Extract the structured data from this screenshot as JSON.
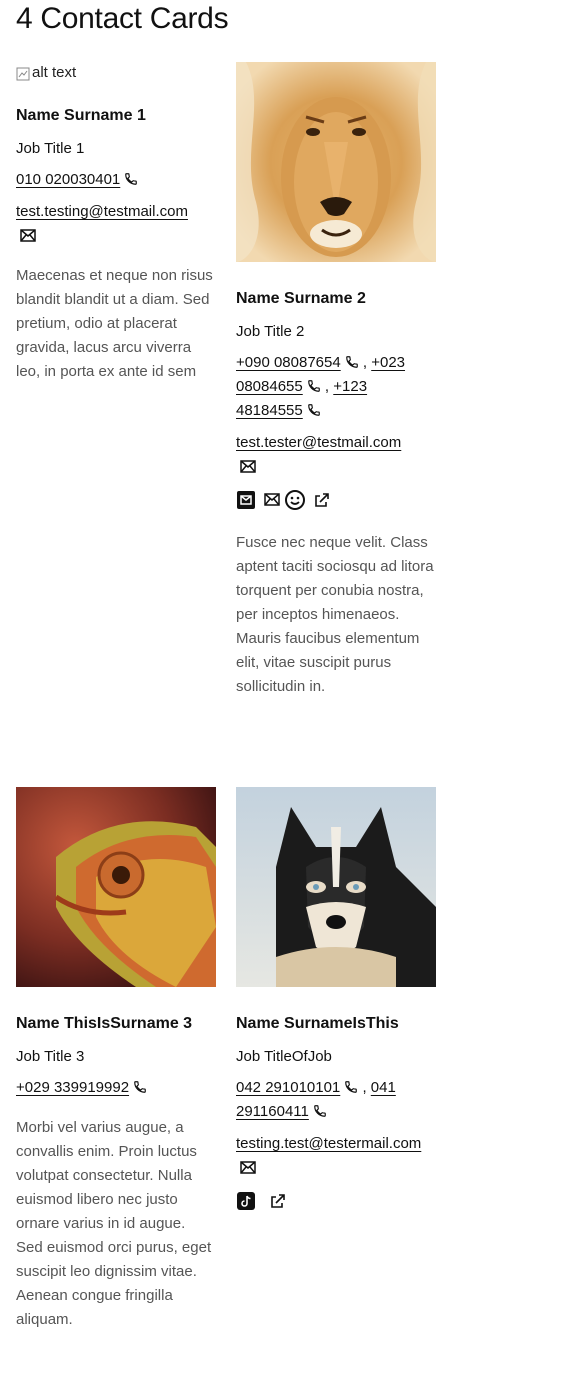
{
  "page": {
    "title": "4 Contact Cards"
  },
  "cards": [
    {
      "image_alt": "alt text",
      "name": "Name Surname 1",
      "job_title": "Job Title 1",
      "phones": [
        "010 020030401"
      ],
      "email": "test.testing@testmail.com",
      "description": "Maecenas et neque non risus blandit blandit ut a diam. Sed pretium, odio at placerat gravida, lacus arcu viverra leo, in porta ex ante id sem"
    },
    {
      "image_subject": "lion",
      "name": "Name Surname 2",
      "job_title": "Job Title 2",
      "phones": [
        "+090 08087654",
        "+023 08084655",
        "+123 48184555"
      ],
      "email": "test.tester@testmail.com",
      "social_icons": [
        "email-square-icon",
        "envelope-icon",
        "smiley-icon",
        "external-link-icon"
      ],
      "description": "Fusce nec neque velit. Class aptent taciti sociosqu ad litora torquent per conubia nostra, per inceptos himenaeos. Mauris faucibus elementum elit, vitae suscipit purus sollicitudin in."
    },
    {
      "image_subject": "chameleon",
      "name": "Name ThisIsSurname 3",
      "job_title": "Job Title 3",
      "phones": [
        "+029 339919992"
      ],
      "description": "Morbi vel varius augue, a convallis enim. Proin luctus volutpat consectetur. Nulla euismod libero nec justo ornare varius in id augue. Sed euismod orci purus, eget suscipit leo dignissim vitae. Aenean congue fringilla aliquam."
    },
    {
      "image_subject": "husky",
      "name": "Name SurnameIsThis",
      "job_title": "Job TitleOfJob",
      "phones": [
        "042 291010101",
        "041 291160411"
      ],
      "email": "testing.test@testermail.com",
      "social_icons": [
        "tiktok-icon",
        "external-link-icon"
      ]
    }
  ],
  "colors": {
    "text": "#111111",
    "muted_text": "#555555",
    "background": "#ffffff"
  }
}
